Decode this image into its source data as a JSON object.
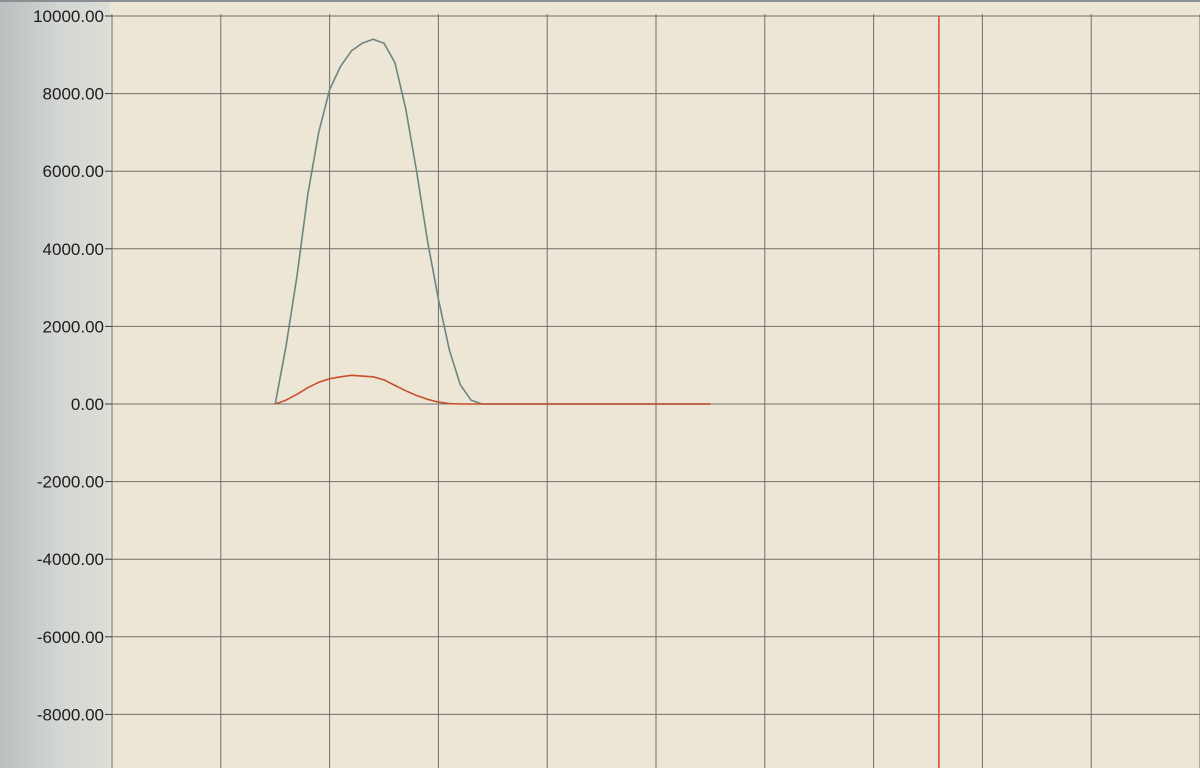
{
  "chart_data": {
    "type": "line",
    "title": "",
    "xlabel": "",
    "ylabel": "",
    "ylim": [
      -9000,
      10000
    ],
    "xlim": [
      0,
      100
    ],
    "y_ticks": [
      10000,
      8000,
      6000,
      4000,
      2000,
      0,
      -2000,
      -4000,
      -6000,
      -8000
    ],
    "y_tick_labels": [
      "10000.00",
      "8000.00",
      "6000.00",
      "4000.00",
      "2000.00",
      "0.00",
      "-2000.00",
      "-4000.00",
      "-6000.00",
      "-8000.00"
    ],
    "x_gridlines": [
      0,
      10,
      20,
      30,
      40,
      50,
      60,
      70,
      80,
      90,
      100
    ],
    "grid": true,
    "series": [
      {
        "color": "#6d8580",
        "x": [
          15,
          16,
          17,
          18,
          19,
          20,
          21,
          22,
          23,
          24,
          25,
          26,
          27,
          28,
          29,
          30,
          31,
          32,
          33,
          34,
          35,
          36,
          37,
          38,
          39,
          40,
          41,
          42,
          43,
          44,
          45,
          46,
          47,
          48,
          49,
          50,
          51,
          52,
          53,
          54,
          55
        ],
        "y": [
          0,
          1500,
          3300,
          5400,
          7000,
          8100,
          8700,
          9100,
          9300,
          9400,
          9300,
          8800,
          7600,
          6000,
          4200,
          2700,
          1400,
          500,
          100,
          0,
          0,
          0,
          0,
          0,
          0,
          0,
          0,
          0,
          0,
          0,
          0,
          0,
          0,
          0,
          0,
          0,
          0,
          0,
          0,
          0,
          0
        ]
      },
      {
        "color": "#c8502a",
        "x": [
          15,
          16,
          17,
          18,
          19,
          20,
          21,
          22,
          23,
          24,
          25,
          26,
          27,
          28,
          29,
          30,
          31,
          32,
          33,
          34,
          35,
          36,
          37,
          38,
          39,
          40,
          41,
          42,
          43,
          44,
          45,
          46,
          47,
          48,
          49,
          50,
          51,
          52,
          53,
          54,
          55
        ],
        "y": [
          0,
          100,
          250,
          420,
          560,
          650,
          700,
          740,
          720,
          700,
          620,
          480,
          340,
          220,
          120,
          50,
          10,
          0,
          0,
          0,
          0,
          0,
          0,
          0,
          0,
          0,
          0,
          0,
          0,
          0,
          0,
          0,
          0,
          0,
          0,
          0,
          0,
          0,
          0,
          0,
          0
        ]
      }
    ],
    "markers": [
      {
        "x": 76,
        "y_from": 10000,
        "y_to": -9000,
        "color": "#d9452a"
      }
    ]
  }
}
